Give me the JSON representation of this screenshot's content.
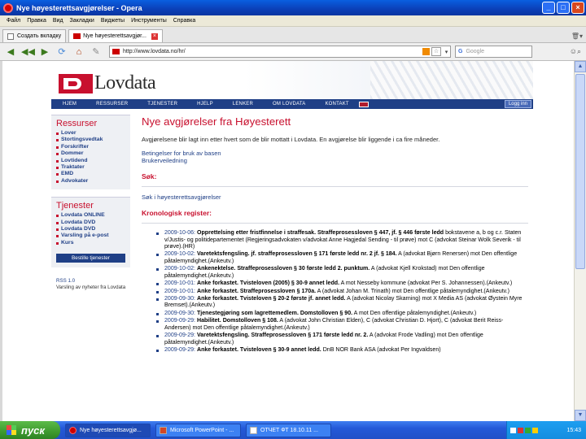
{
  "window": {
    "title": "Nye høyesterettsavgjørelser - Opera"
  },
  "menu": [
    "Файл",
    "Правка",
    "Вид",
    "Закладки",
    "Виджеты",
    "Инструменты",
    "Справка"
  ],
  "tabs": [
    {
      "label": "Создать вкладку",
      "active": false
    },
    {
      "label": "Nye høyesterettsavgjør...",
      "active": true
    }
  ],
  "toolbar": {
    "url": "http://www.lovdata.no/hr/",
    "search_placeholder": "Google",
    "search_engine": "G"
  },
  "site": {
    "logo_text": "Lovdata",
    "nav": [
      "HJEM",
      "RESSURSER",
      "TJENESTER",
      "HJELP",
      "LENKER",
      "OM LOVDATA",
      "KONTAKT"
    ],
    "login": "Logg inn",
    "sidebar": {
      "ressurser_title": "Ressurser",
      "ressurser_links": [
        "Lover",
        "Stortingsvedtak",
        "Forskrifter",
        "Dommer",
        "Lovtidend",
        "Traktater",
        "EMD",
        "Advokater"
      ],
      "tjenester_title": "Tjenester",
      "tjenester_links": [
        "Lovdata ONLINE",
        "Lovdata DVD",
        "Lovdata DVD",
        "Varsling på e-post",
        "Kurs"
      ],
      "tjenester_button": "Bestille tjenester",
      "rss_label": "RSS 1.0",
      "rss_text": "Varsling av nyheter fra Lovdata"
    },
    "main": {
      "title": "Nye avgjørelser fra Høyesterett",
      "intro": "Avgjørelsene blir lagt inn etter hvert som de blir mottatt i Lovdata. En avgjørelse blir liggende i ca fire måneder.",
      "link1": "Betingelser for bruk av basen",
      "link2": "Brukerveiledning",
      "search_heading": "Søk:",
      "search_link": "Søk i høyesterettsavgjørelser",
      "register_heading": "Kronologisk register:",
      "register": [
        {
          "date": "2009-10-06:",
          "head": "Opprettelsing etter fristfinnelse i straffesak. Straffeprosessloven § 447, jf. § 446 første ledd",
          "rest": "bokstavene a, b og c.r. Staten v/Justis- og politidepartementet (Regjeringsadvokaten v/advokat Anne Hagjedal Sending - til prøve) mot C (advokat Steinar Wolk Severik - til prøve).(HR)"
        },
        {
          "date": "2009-10-02:",
          "head": "Varetektsfengsling. jf. straffeprosessloven § 171 første ledd nr. 2 jf. § 184.",
          "rest": "A (advokat Bjørn Renersen) mot Den offentlige påtalemyndighet.(Ankeutv.)"
        },
        {
          "date": "2009-10-02:",
          "head": "Ankenektelse. Straffeprosessloven § 30 første ledd 2. punktum.",
          "rest": "A (advokat Kjell Krokstad) mot Den offentlige påtalemyndighet.(Ankeutv.)"
        },
        {
          "date": "2009-10-01:",
          "head": "Anke forkastet. Tvisteloven (2005) § 30-9 annet ledd.",
          "rest": "A mot Nesseby kommune (advokat Per S. Johannessen).(Ankeutv.)"
        },
        {
          "date": "2009-10-01:",
          "head": "Anke forkastet. Straffeprosessloven § 170a.",
          "rest": "A (advokat Johan M. Trinath) mot Den offentlige påtalemyndighet.(Ankeutv.)"
        },
        {
          "date": "2009-09-30:",
          "head": "Anke forkastet. Tvisteloven § 20-2 første jf. annet ledd.",
          "rest": "A (advokat Nicolay Skarning) mot X Media AS (advokat Øystein Myre Bremset).(Ankeutv.)"
        },
        {
          "date": "2009-09-30:",
          "head": "Tjenestegjøring som lagrettemedlem. Domstolloven § 90.",
          "rest": "A mot Den offentlige påtalemyndighet.(Ankeutv.)"
        },
        {
          "date": "2009-09-29:",
          "head": "Habilitet. Domstolloven § 108.",
          "rest": "A (advokat John Christian Elden), C (advokat Christian D. Hjort), C (advokat Berit Reiss-Andersen) mot Den offentlige påtalemyndighet.(Ankeutv.)"
        },
        {
          "date": "2009-09-29:",
          "head": "Varetektsfengsling. Straffeprosessloven § 171 første ledd nr. 2.",
          "rest": "A (advokat Frode Vadling) mot Den offentlige påtalemyndighet.(Ankeutv.)"
        },
        {
          "date": "2009-09-29:",
          "head": "Anke forkastet. Tvisteloven § 30-9 annet ledd.",
          "rest": "DnB NOR Bank ASA (advokat Per Ingvaldsen)"
        }
      ]
    }
  },
  "taskbar": {
    "start": "пуск",
    "tasks": [
      {
        "label": "Nye høyesterettsavgjø...",
        "icon": "opera",
        "active": true
      },
      {
        "label": "Microsoft PowerPoint - ...",
        "icon": "ppt",
        "active": false
      },
      {
        "label": "ОТЧЕТ ФТ 18.10.11 ...",
        "icon": "doc",
        "active": false
      }
    ],
    "clock": "15:43"
  }
}
